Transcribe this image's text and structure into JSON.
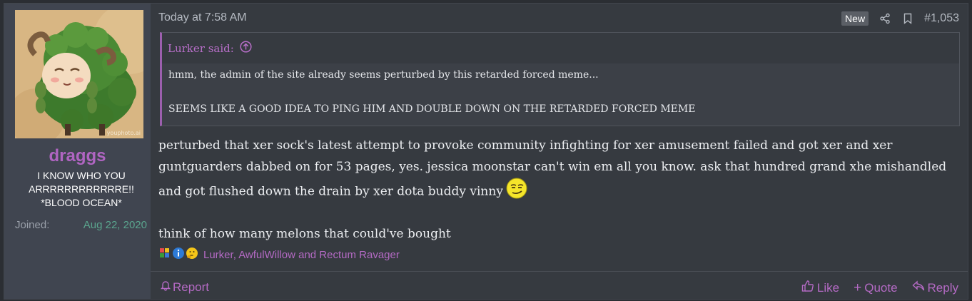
{
  "user": {
    "username": "draggs",
    "title": "I KNOW WHO YOU ARRRRRRRRRRRRE!! *BLOOD OCEAN*",
    "joined_label": "Joined:",
    "joined_value": "Aug 22, 2020",
    "avatar_watermark": "youphoto.ai"
  },
  "post": {
    "date": "Today at 7:58 AM",
    "new_badge": "New",
    "number": "#1,053",
    "share_icon": "share-icon",
    "bookmark_icon": "bookmark-icon"
  },
  "quote": {
    "author_label": "Lurker said:",
    "line1": "hmm, the admin of the site already seems perturbed by this retarded forced meme...",
    "line2": "SEEMS LIKE A GOOD IDEA TO PING HIM AND DOUBLE DOWN ON THE RETARDED FORCED MEME"
  },
  "message": {
    "paragraph1": "perturbed that xer sock's latest attempt to provoke community infighting for xer amusement failed and got xer and xer guntguarders dabbed on for 53 pages, yes. jessica moonstar can't win em all you know. ask that hundred grand xhe mishandled and got flushed down the drain by xer dota buddy vinny",
    "paragraph2": "think of how many melons that could've bought"
  },
  "reactions": {
    "text": "Lurker, AwfulWillow and Rectum Ravager"
  },
  "footer": {
    "report": "Report",
    "like": "Like",
    "quote": "Quote",
    "reply": "Reply"
  },
  "colors": {
    "accent": "#b46ac4",
    "username": "#b065c2",
    "joined": "#5aa58e",
    "background": "#363a40"
  }
}
